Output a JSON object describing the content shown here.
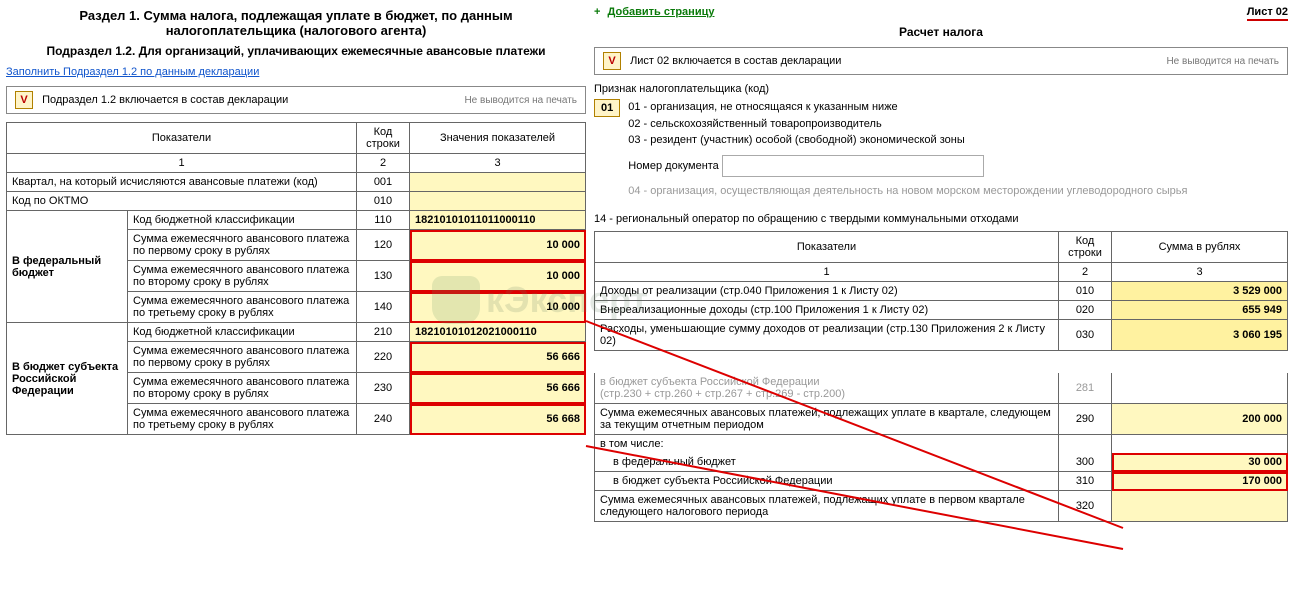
{
  "left": {
    "title1": "Раздел 1. Сумма налога, подлежащая уплате в бюджет, по данным",
    "title2": "налогоплательщика (налогового агента)",
    "subtitle": "Подраздел 1.2. Для организаций, уплачивающих ежемесячные авансовые платежи",
    "fill_link": "Заполнить Подраздел 1.2 по данным декларации",
    "include_text": "Подраздел 1.2 включается в состав декларации",
    "noprint": "Не выводится на печать",
    "headers": {
      "indicators": "Показатели",
      "code": "Код строки",
      "value": "Значения показателей",
      "n1": "1",
      "n2": "2",
      "n3": "3"
    },
    "rows": {
      "quarter": "Квартал, на который исчисляются авансовые платежи (код)",
      "quarter_code": "001",
      "oktmo": "Код по ОКТМО",
      "oktmo_code": "010",
      "fed_label": "В федеральный бюджет",
      "fed_kbk": "Код бюджетной классификации",
      "fed_kbk_code": "110",
      "fed_kbk_val": "18210101011011000110",
      "fed_s1": "Сумма ежемесячного авансового платежа по первому сроку в рублях",
      "fed_s1_code": "120",
      "fed_s1_val": "10 000",
      "fed_s2": "Сумма ежемесячного авансового платежа по второму сроку в рублях",
      "fed_s2_code": "130",
      "fed_s2_val": "10 000",
      "fed_s3": "Сумма ежемесячного авансового платежа по третьему сроку в рублях",
      "fed_s3_code": "140",
      "fed_s3_val": "10 000",
      "sub_label": "В бюджет субъекта Российской Федерации",
      "sub_kbk": "Код бюджетной классификации",
      "sub_kbk_code": "210",
      "sub_kbk_val": "18210101012021000110",
      "sub_s1": "Сумма ежемесячного авансового платежа по первому сроку в рублях",
      "sub_s1_code": "220",
      "sub_s1_val": "56 666",
      "sub_s2": "Сумма ежемесячного авансового платежа по второму сроку в рублях",
      "sub_s2_code": "230",
      "sub_s2_val": "56 666",
      "sub_s3": "Сумма ежемесячного авансового платежа по третьему сроку в рублях",
      "sub_s3_code": "240",
      "sub_s3_val": "56 668"
    }
  },
  "right": {
    "add_page": "Добавить страницу",
    "sheet": "Лист 02",
    "title": "Расчет налога",
    "include_text": "Лист 02 включается в состав декларации",
    "noprint": "Не выводится на печать",
    "taxpayer_label": "Признак налогоплательщика (код)",
    "code01": "01",
    "opt1": "01 - организация, не относящаяся к указанным ниже",
    "opt2": "02 - сельскохозяйственный товаропроизводитель",
    "opt3": "03 - резидент (участник) особой (свободной) экономической зоны",
    "docnum_label": "Номер документа",
    "grey_line": "04 - организация, осуществляющая деятельность на новом морском месторождении углеводородного сырья",
    "opt14": "14 - региональный оператор по обращению с твердыми коммунальными отходами",
    "headers": {
      "indicators": "Показатели",
      "code": "Код строки",
      "sum": "Сумма в рублях",
      "n1": "1",
      "n2": "2",
      "n3": "3"
    },
    "rows": {
      "r010": "Доходы от реализации (стр.040 Приложения 1 к Листу 02)",
      "r010_c": "010",
      "r010_v": "3 529 000",
      "r020": "Внереализационные доходы (стр.100 Приложения 1 к Листу 02)",
      "r020_c": "020",
      "r020_v": "655 949",
      "r030": "Расходы, уменьшающие сумму доходов от реализации (стр.130 Приложения 2 к Листу 02)",
      "r030_c": "030",
      "r030_v": "3 060 195",
      "r281g": "в бюджет субъекта Российской Федерации",
      "r281g2": "(стр.230 + стр.260 + стр.267 + стр.269 - стр.200)",
      "r281_c": "281",
      "r290": "Сумма ежемесячных авансовых платежей, подлежащих уплате в квартале, следующем за текущим отчетным периодом",
      "r290_c": "290",
      "r290_v": "200 000",
      "inc": "в том числе:",
      "r300": "в федеральный бюджет",
      "r300_c": "300",
      "r300_v": "30 000",
      "r310": "в бюджет субъекта Российской Федерации",
      "r310_c": "310",
      "r310_v": "170 000",
      "r320": "Сумма ежемесячных авансовых платежей, подлежащих уплате в первом квартале следующего налогового периода",
      "r320_c": "320"
    }
  },
  "watermark": "кЭксперт"
}
